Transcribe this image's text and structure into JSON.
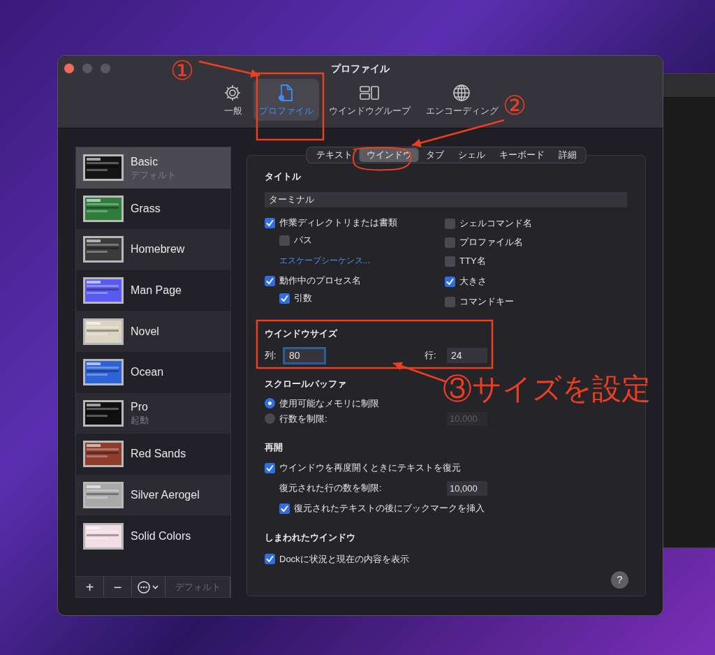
{
  "window": {
    "title": "プロファイル"
  },
  "toolbar": [
    {
      "label": "一般",
      "kind": "gear",
      "selected": false
    },
    {
      "label": "プロファイル",
      "kind": "profile",
      "selected": true
    },
    {
      "label": "ウインドウグループ",
      "kind": "group",
      "selected": false
    },
    {
      "label": "エンコーディング",
      "kind": "globe",
      "selected": false
    }
  ],
  "profiles": [
    {
      "name": "Basic",
      "subtitle": "デフォルト",
      "selected": true,
      "color": "#141414"
    },
    {
      "name": "Grass",
      "selected": false,
      "color": "#2f7d3b"
    },
    {
      "name": "Homebrew",
      "selected": false,
      "color": "#3b3b3b"
    },
    {
      "name": "Man Page",
      "selected": false,
      "color": "#5a5af2"
    },
    {
      "name": "Novel",
      "selected": false,
      "color": "#d9d5c2"
    },
    {
      "name": "Ocean",
      "selected": false,
      "color": "#2c64d8"
    },
    {
      "name": "Pro",
      "subtitle": "起動",
      "selected": false,
      "color": "#101010"
    },
    {
      "name": "Red Sands",
      "selected": false,
      "color": "#8e3c2c"
    },
    {
      "name": "Silver Aerogel",
      "selected": false,
      "color": "#a9a9a9"
    },
    {
      "name": "Solid Colors",
      "selected": false,
      "color": "#f1dde3"
    }
  ],
  "profile_buttons": [
    {
      "kind": "add",
      "label": "+"
    },
    {
      "kind": "remove",
      "label": "−"
    },
    {
      "kind": "more"
    },
    {
      "kind": "default",
      "label": "デフォルト",
      "disabled": true
    }
  ],
  "tabs": [
    {
      "label": "テキスト",
      "selected": false
    },
    {
      "label": "ウインドウ",
      "selected": true
    },
    {
      "label": "タブ",
      "selected": false
    },
    {
      "label": "シェル",
      "selected": false
    },
    {
      "label": "キーボード",
      "selected": false
    },
    {
      "label": "詳細",
      "selected": false
    }
  ],
  "title_section": {
    "heading": "タイトル",
    "value": "ターミナル",
    "left_options": [
      {
        "kind": "checkbox",
        "label": "作業ディレクトリまたは書類",
        "checked": true,
        "children": [
          {
            "kind": "checkbox",
            "label": "パス",
            "checked": false
          },
          {
            "kind": "link",
            "label": "エスケープシーケンス..."
          }
        ]
      },
      {
        "kind": "checkbox",
        "label": "動作中のプロセス名",
        "checked": true,
        "children": [
          {
            "kind": "checkbox",
            "label": "引数",
            "checked": true
          }
        ]
      }
    ],
    "right_options": [
      {
        "label": "シェルコマンド名",
        "checked": false
      },
      {
        "label": "プロファイル名",
        "checked": false
      },
      {
        "label": "TTY名",
        "checked": false
      },
      {
        "label": "大きさ",
        "checked": true
      },
      {
        "label": "コマンドキー",
        "checked": false
      }
    ]
  },
  "window_size": {
    "heading": "ウインドウサイズ",
    "columns_label": "列:",
    "columns": "80",
    "columns_focused": true,
    "rows_label": "行:",
    "rows": "24"
  },
  "scrollback": {
    "heading": "スクロールバッファ",
    "options": [
      {
        "label": "使用可能なメモリに制限",
        "selected": true
      },
      {
        "label": "行数を制限:",
        "selected": false,
        "value": "10,000"
      }
    ]
  },
  "resume": {
    "heading": "再開",
    "label": "ウインドウを再度開くときにテキストを復元",
    "checked": true,
    "limit_label": "復元された行の数を制限:",
    "limit_value": "10,000",
    "bookmark_label": "復元されたテキストの後にブックマークを挿入",
    "bookmark_checked": true
  },
  "minimized": {
    "heading": "しまわれたウインドウ",
    "label": "Dockに状況と現在の内容を表示",
    "checked": true
  },
  "help": "?",
  "annotations": [
    "①",
    "②",
    "③サイズを設定"
  ]
}
